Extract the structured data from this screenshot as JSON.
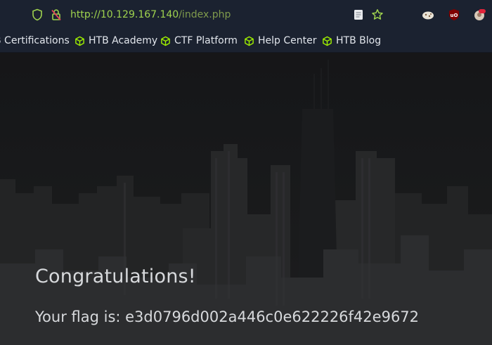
{
  "browser": {
    "url_host": "http://10.129.167.140",
    "url_path": "/index.php",
    "bookmarks": [
      {
        "label": "B Certifications",
        "icon": "htb-cube-icon"
      },
      {
        "label": "HTB Academy",
        "icon": "htb-cube-icon"
      },
      {
        "label": "CTF Platform",
        "icon": "htb-cube-icon"
      },
      {
        "label": "Help Center",
        "icon": "htb-cube-icon"
      },
      {
        "label": "HTB Blog",
        "icon": "htb-cube-icon"
      }
    ],
    "toolbar_icons": [
      "shield-icon",
      "connection-not-secure-icon",
      "reader-view-icon",
      "bookmark-star-icon",
      "cookie-extension-icon",
      "ublock-origin-icon",
      "profile-extension-icon"
    ]
  },
  "colors": {
    "chrome_bg": "#1b2230",
    "accent_green": "#9fd34e",
    "page_bg": "#191b1d",
    "page_text": "#d7d9dc"
  },
  "page": {
    "heading": "Congratulations!",
    "flag_text": "Your flag is: e3d0796d002a446c0e622226f42e9672"
  }
}
